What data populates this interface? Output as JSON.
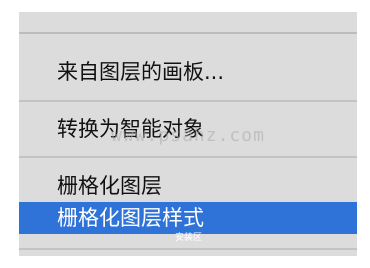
{
  "menu": {
    "items": [
      {
        "label": "来自图层的画板..."
      },
      {
        "label": "转换为智能对象"
      },
      {
        "label": "栅格化图层"
      },
      {
        "label": "栅格化图层样式"
      }
    ]
  },
  "watermark": {
    "url": "www.psahz.com",
    "small": "安装区"
  },
  "colors": {
    "menu_bg": "#dcdcdc",
    "selected_bg": "#2f73d8",
    "separator": "#c3c3c3"
  }
}
